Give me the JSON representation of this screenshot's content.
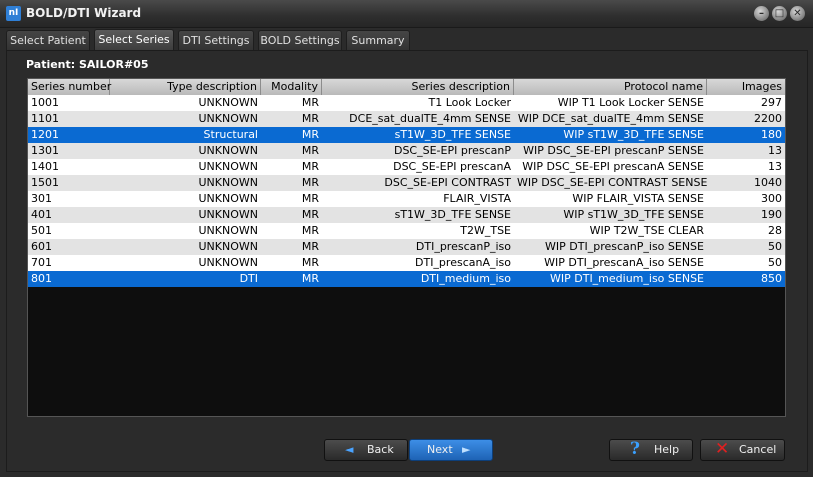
{
  "window": {
    "icon_text": "nI",
    "title": "BOLD/DTI Wizard",
    "minimize_glyph": "–",
    "restore_glyph": "□",
    "close_glyph": "✕"
  },
  "tabs": [
    {
      "label": "Select Patient"
    },
    {
      "label": "Select Series"
    },
    {
      "label": "DTI Settings"
    },
    {
      "label": "BOLD Settings"
    },
    {
      "label": "Summary"
    }
  ],
  "active_tab": "Select Series",
  "patient_label": "Patient: SAILOR#05",
  "table": {
    "headers": [
      "Series number",
      "Type description",
      "Modality",
      "Series description",
      "Protocol name",
      "Images"
    ],
    "rows": [
      {
        "num": "1001",
        "type": "UNKNOWN",
        "mod": "MR",
        "desc": "T1 Look Locker",
        "proto": "WIP T1 Look Locker SENSE",
        "images": "297",
        "selected": false
      },
      {
        "num": "1101",
        "type": "UNKNOWN",
        "mod": "MR",
        "desc": "DCE_sat_dualTE_4mm SENSE",
        "proto": "WIP DCE_sat_dualTE_4mm SENSE",
        "images": "2200",
        "selected": false
      },
      {
        "num": "1201",
        "type": "Structural",
        "mod": "MR",
        "desc": "sT1W_3D_TFE SENSE",
        "proto": "WIP sT1W_3D_TFE SENSE",
        "images": "180",
        "selected": true
      },
      {
        "num": "1301",
        "type": "UNKNOWN",
        "mod": "MR",
        "desc": "DSC_SE-EPI prescanP",
        "proto": "WIP DSC_SE-EPI prescanP SENSE",
        "images": "13",
        "selected": false
      },
      {
        "num": "1401",
        "type": "UNKNOWN",
        "mod": "MR",
        "desc": "DSC_SE-EPI prescanA",
        "proto": "WIP DSC_SE-EPI prescanA SENSE",
        "images": "13",
        "selected": false
      },
      {
        "num": "1501",
        "type": "UNKNOWN",
        "mod": "MR",
        "desc": "DSC_SE-EPI CONTRAST",
        "proto": "WIP DSC_SE-EPI CONTRAST SENSE",
        "images": "1040",
        "selected": false
      },
      {
        "num": "301",
        "type": "UNKNOWN",
        "mod": "MR",
        "desc": "FLAIR_VISTA",
        "proto": "WIP FLAIR_VISTA SENSE",
        "images": "300",
        "selected": false
      },
      {
        "num": "401",
        "type": "UNKNOWN",
        "mod": "MR",
        "desc": "sT1W_3D_TFE SENSE",
        "proto": "WIP sT1W_3D_TFE SENSE",
        "images": "190",
        "selected": false
      },
      {
        "num": "501",
        "type": "UNKNOWN",
        "mod": "MR",
        "desc": "T2W_TSE",
        "proto": "WIP T2W_TSE CLEAR",
        "images": "28",
        "selected": false
      },
      {
        "num": "601",
        "type": "UNKNOWN",
        "mod": "MR",
        "desc": "DTI_prescanP_iso",
        "proto": "WIP DTI_prescanP_iso SENSE",
        "images": "50",
        "selected": false
      },
      {
        "num": "701",
        "type": "UNKNOWN",
        "mod": "MR",
        "desc": "DTI_prescanA_iso",
        "proto": "WIP DTI_prescanA_iso SENSE",
        "images": "50",
        "selected": false
      },
      {
        "num": "801",
        "type": "DTI",
        "mod": "MR",
        "desc": "DTI_medium_iso",
        "proto": "WIP DTI_medium_iso SENSE",
        "images": "850",
        "selected": true
      }
    ]
  },
  "buttons": {
    "back": "Back",
    "next": "Next",
    "help": "Help",
    "cancel": "Cancel",
    "back_icon": "◄",
    "next_icon": "►",
    "help_icon": "?",
    "cancel_icon": "✕"
  },
  "colors": {
    "selection": "#0a6ad2",
    "row_even": "#ffffff",
    "row_odd": "#e3e3e3",
    "accent": "#2f7fd6"
  }
}
